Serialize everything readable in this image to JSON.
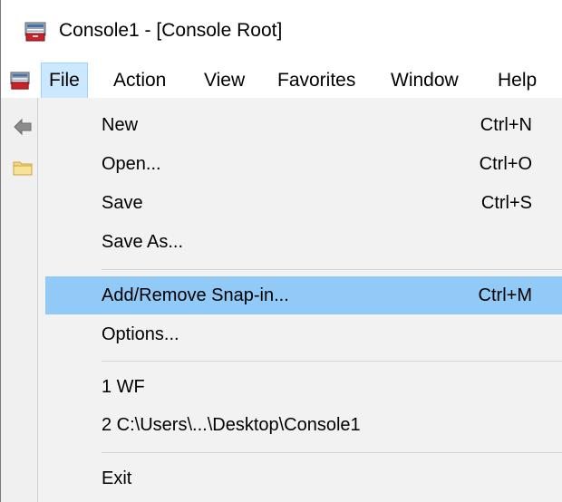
{
  "window": {
    "title": "Console1 - [Console Root]",
    "icon": "mmc-console-icon"
  },
  "menubar": {
    "icon": "mmc-console-icon",
    "items": [
      {
        "label": "File",
        "active": true
      },
      {
        "label": "Action"
      },
      {
        "label": "View"
      },
      {
        "label": "Favorites"
      },
      {
        "label": "Window"
      },
      {
        "label": "Help"
      }
    ]
  },
  "toolbar": {
    "back_icon": "back-arrow-icon",
    "tree_icon": "folder-icon"
  },
  "file_menu": {
    "new": {
      "label": "New",
      "shortcut": "Ctrl+N"
    },
    "open": {
      "label": "Open...",
      "shortcut": "Ctrl+O"
    },
    "save": {
      "label": "Save",
      "shortcut": "Ctrl+S"
    },
    "save_as": {
      "label": "Save As..."
    },
    "add_remove_snapin": {
      "label": "Add/Remove Snap-in...",
      "shortcut": "Ctrl+M",
      "highlighted": true
    },
    "options": {
      "label": "Options..."
    },
    "recent_1": {
      "label": "1 WF"
    },
    "recent_2": {
      "label": "2 C:\\Users\\...\\Desktop\\Console1"
    },
    "exit": {
      "label": "Exit"
    }
  },
  "colors": {
    "highlight": "#91c9f7",
    "menu_background": "#f2f2f2",
    "active_menu": "#cce8ff"
  }
}
